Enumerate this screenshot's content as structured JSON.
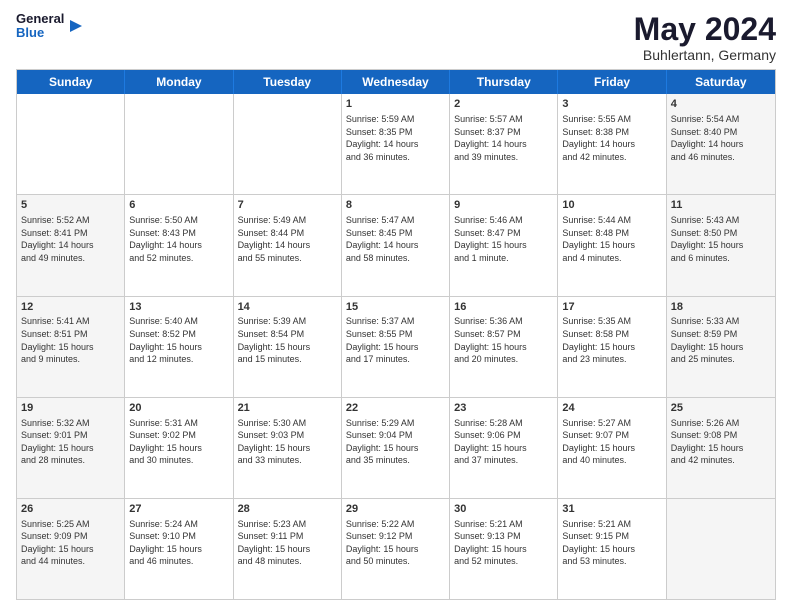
{
  "header": {
    "logo_general": "General",
    "logo_blue": "Blue",
    "month_year": "May 2024",
    "location": "Buhlertann, Germany"
  },
  "days_of_week": [
    "Sunday",
    "Monday",
    "Tuesday",
    "Wednesday",
    "Thursday",
    "Friday",
    "Saturday"
  ],
  "weeks": [
    [
      {
        "day": "",
        "info": "",
        "shaded": false
      },
      {
        "day": "",
        "info": "",
        "shaded": false
      },
      {
        "day": "",
        "info": "",
        "shaded": false
      },
      {
        "day": "1",
        "info": "Sunrise: 5:59 AM\nSunset: 8:35 PM\nDaylight: 14 hours\nand 36 minutes.",
        "shaded": false
      },
      {
        "day": "2",
        "info": "Sunrise: 5:57 AM\nSunset: 8:37 PM\nDaylight: 14 hours\nand 39 minutes.",
        "shaded": false
      },
      {
        "day": "3",
        "info": "Sunrise: 5:55 AM\nSunset: 8:38 PM\nDaylight: 14 hours\nand 42 minutes.",
        "shaded": false
      },
      {
        "day": "4",
        "info": "Sunrise: 5:54 AM\nSunset: 8:40 PM\nDaylight: 14 hours\nand 46 minutes.",
        "shaded": true
      }
    ],
    [
      {
        "day": "5",
        "info": "Sunrise: 5:52 AM\nSunset: 8:41 PM\nDaylight: 14 hours\nand 49 minutes.",
        "shaded": true
      },
      {
        "day": "6",
        "info": "Sunrise: 5:50 AM\nSunset: 8:43 PM\nDaylight: 14 hours\nand 52 minutes.",
        "shaded": false
      },
      {
        "day": "7",
        "info": "Sunrise: 5:49 AM\nSunset: 8:44 PM\nDaylight: 14 hours\nand 55 minutes.",
        "shaded": false
      },
      {
        "day": "8",
        "info": "Sunrise: 5:47 AM\nSunset: 8:45 PM\nDaylight: 14 hours\nand 58 minutes.",
        "shaded": false
      },
      {
        "day": "9",
        "info": "Sunrise: 5:46 AM\nSunset: 8:47 PM\nDaylight: 15 hours\nand 1 minute.",
        "shaded": false
      },
      {
        "day": "10",
        "info": "Sunrise: 5:44 AM\nSunset: 8:48 PM\nDaylight: 15 hours\nand 4 minutes.",
        "shaded": false
      },
      {
        "day": "11",
        "info": "Sunrise: 5:43 AM\nSunset: 8:50 PM\nDaylight: 15 hours\nand 6 minutes.",
        "shaded": true
      }
    ],
    [
      {
        "day": "12",
        "info": "Sunrise: 5:41 AM\nSunset: 8:51 PM\nDaylight: 15 hours\nand 9 minutes.",
        "shaded": true
      },
      {
        "day": "13",
        "info": "Sunrise: 5:40 AM\nSunset: 8:52 PM\nDaylight: 15 hours\nand 12 minutes.",
        "shaded": false
      },
      {
        "day": "14",
        "info": "Sunrise: 5:39 AM\nSunset: 8:54 PM\nDaylight: 15 hours\nand 15 minutes.",
        "shaded": false
      },
      {
        "day": "15",
        "info": "Sunrise: 5:37 AM\nSunset: 8:55 PM\nDaylight: 15 hours\nand 17 minutes.",
        "shaded": false
      },
      {
        "day": "16",
        "info": "Sunrise: 5:36 AM\nSunset: 8:57 PM\nDaylight: 15 hours\nand 20 minutes.",
        "shaded": false
      },
      {
        "day": "17",
        "info": "Sunrise: 5:35 AM\nSunset: 8:58 PM\nDaylight: 15 hours\nand 23 minutes.",
        "shaded": false
      },
      {
        "day": "18",
        "info": "Sunrise: 5:33 AM\nSunset: 8:59 PM\nDaylight: 15 hours\nand 25 minutes.",
        "shaded": true
      }
    ],
    [
      {
        "day": "19",
        "info": "Sunrise: 5:32 AM\nSunset: 9:01 PM\nDaylight: 15 hours\nand 28 minutes.",
        "shaded": true
      },
      {
        "day": "20",
        "info": "Sunrise: 5:31 AM\nSunset: 9:02 PM\nDaylight: 15 hours\nand 30 minutes.",
        "shaded": false
      },
      {
        "day": "21",
        "info": "Sunrise: 5:30 AM\nSunset: 9:03 PM\nDaylight: 15 hours\nand 33 minutes.",
        "shaded": false
      },
      {
        "day": "22",
        "info": "Sunrise: 5:29 AM\nSunset: 9:04 PM\nDaylight: 15 hours\nand 35 minutes.",
        "shaded": false
      },
      {
        "day": "23",
        "info": "Sunrise: 5:28 AM\nSunset: 9:06 PM\nDaylight: 15 hours\nand 37 minutes.",
        "shaded": false
      },
      {
        "day": "24",
        "info": "Sunrise: 5:27 AM\nSunset: 9:07 PM\nDaylight: 15 hours\nand 40 minutes.",
        "shaded": false
      },
      {
        "day": "25",
        "info": "Sunrise: 5:26 AM\nSunset: 9:08 PM\nDaylight: 15 hours\nand 42 minutes.",
        "shaded": true
      }
    ],
    [
      {
        "day": "26",
        "info": "Sunrise: 5:25 AM\nSunset: 9:09 PM\nDaylight: 15 hours\nand 44 minutes.",
        "shaded": true
      },
      {
        "day": "27",
        "info": "Sunrise: 5:24 AM\nSunset: 9:10 PM\nDaylight: 15 hours\nand 46 minutes.",
        "shaded": false
      },
      {
        "day": "28",
        "info": "Sunrise: 5:23 AM\nSunset: 9:11 PM\nDaylight: 15 hours\nand 48 minutes.",
        "shaded": false
      },
      {
        "day": "29",
        "info": "Sunrise: 5:22 AM\nSunset: 9:12 PM\nDaylight: 15 hours\nand 50 minutes.",
        "shaded": false
      },
      {
        "day": "30",
        "info": "Sunrise: 5:21 AM\nSunset: 9:13 PM\nDaylight: 15 hours\nand 52 minutes.",
        "shaded": false
      },
      {
        "day": "31",
        "info": "Sunrise: 5:21 AM\nSunset: 9:15 PM\nDaylight: 15 hours\nand 53 minutes.",
        "shaded": false
      },
      {
        "day": "",
        "info": "",
        "shaded": true
      }
    ]
  ]
}
